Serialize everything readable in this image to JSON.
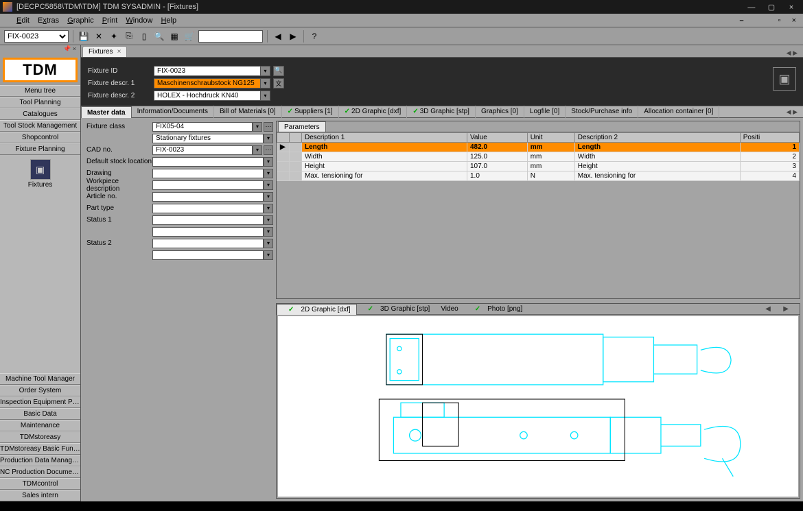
{
  "window": {
    "title": "[DECPC5858\\TDM\\TDM] TDM SYSADMIN - [Fixtures]"
  },
  "menu": {
    "items": [
      "Edit",
      "Extras",
      "Graphic",
      "Print",
      "Window",
      "Help"
    ]
  },
  "toolbar": {
    "id_value": "FIX-0023"
  },
  "sidebar": {
    "logo": "TDM",
    "upper": [
      "Menu tree",
      "Tool Planning",
      "Catalogues",
      "Tool Stock Management",
      "Shopcontrol",
      "Fixture Planning"
    ],
    "module_label": "Fixtures",
    "lower": [
      "Machine Tool Manager",
      "Order System",
      "Inspection Equipment Plan...",
      "Basic Data",
      "Maintenance",
      "TDMstoreasy",
      "TDMstoreasy Basic Functio",
      "Production Data Managem",
      "NC Production Documents...",
      "TDMcontrol",
      "Sales intern"
    ]
  },
  "tab": {
    "label": "Fixtures"
  },
  "header": {
    "fixture_id_label": "Fixture ID",
    "fixture_id": "FIX-0023",
    "descr1_label": "Fixture descr. 1",
    "descr1": "Maschinenschraubstock NG125",
    "descr2_label": "Fixture descr. 2",
    "descr2": "HOLEX - Hochdruck KN40"
  },
  "subtabs": [
    "Master data",
    "Information/Documents",
    "Bill of Materials [0]",
    "✓Suppliers [1]",
    "✓2D Graphic [dxf]",
    "✓3D Graphic [stp]",
    "Graphics [0]",
    "Logfile [0]",
    "Stock/Purchase info",
    "Allocation container [0]"
  ],
  "form": {
    "rows": [
      {
        "label": "Fixture class",
        "value": "FIX05-04",
        "dd": true,
        "ext": true,
        "sub": "Stationary fixtures",
        "subdd": true
      },
      {
        "label": "CAD no.",
        "value": "FIX-0023",
        "dd": true,
        "ext": true
      },
      {
        "label": "Default stock location",
        "value": "",
        "dd": true
      },
      {
        "label": "Drawing",
        "value": "",
        "dd": true
      },
      {
        "label": "Workpiece description",
        "value": "",
        "dd": true
      },
      {
        "label": "Article no.",
        "value": "",
        "dd": true
      },
      {
        "label": "Part type",
        "value": "",
        "dd": true
      },
      {
        "label": "Status 1",
        "value": "",
        "dd": true,
        "sub": "",
        "subdd": true
      },
      {
        "label": "Status 2",
        "value": "",
        "dd": true,
        "sub": "",
        "subdd": true
      }
    ]
  },
  "parameters": {
    "tab": "Parameters",
    "headers": [
      "Description 1",
      "Value",
      "Unit",
      "Description 2",
      "Positi"
    ],
    "rows": [
      {
        "d1": "Length",
        "val": "482.0",
        "unit": "mm",
        "d2": "Length",
        "pos": "1",
        "sel": true
      },
      {
        "d1": "Width",
        "val": "125.0",
        "unit": "mm",
        "d2": "Width",
        "pos": "2"
      },
      {
        "d1": "Height",
        "val": "107.0",
        "unit": "mm",
        "d2": "Height",
        "pos": "3"
      },
      {
        "d1": "Max. tensioning for",
        "val": "1.0",
        "unit": "N",
        "d2": "Max. tensioning for",
        "pos": "4"
      }
    ]
  },
  "graphic_tabs": [
    "✓2D Graphic [dxf]",
    "✓3D Graphic [stp]",
    "Video",
    "✓Photo [png]"
  ]
}
